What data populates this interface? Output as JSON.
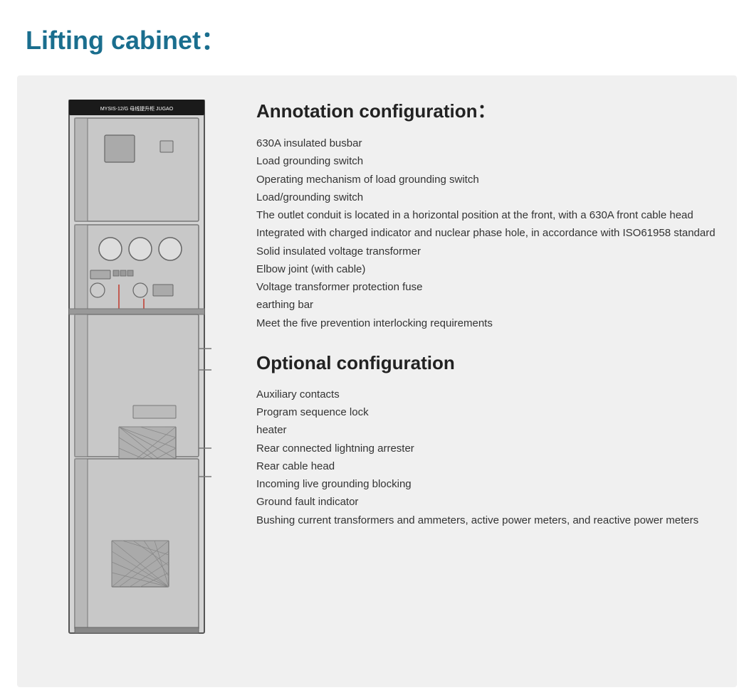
{
  "header": {
    "title": "Lifting cabinet："
  },
  "annotation": {
    "section_title": "Annotation configuration：",
    "items": [
      "630A insulated busbar",
      "Load grounding switch",
      "Operating mechanism of load grounding switch",
      "Load/grounding switch",
      "The outlet conduit is located in a horizontal position at the front, with a 630A front cable head",
      "Integrated with charged indicator and nuclear phase hole, in accordance with ISO61958 standard",
      "Solid insulated voltage transformer",
      "Elbow joint (with cable)",
      "Voltage transformer protection fuse",
      "earthing bar",
      "Meet the five prevention interlocking requirements"
    ]
  },
  "optional": {
    "section_title": "Optional configuration",
    "items": [
      "Auxiliary contacts",
      "Program sequence lock",
      "heater",
      "Rear connected lightning arrester",
      "Rear cable head",
      "Incoming live grounding blocking",
      "Ground fault indicator",
      "Bushing current transformers and ammeters, active power meters, and reactive power meters"
    ]
  },
  "cabinet": {
    "label_top": "MYSIS-12/G  母线提升柜  JUGAO"
  }
}
